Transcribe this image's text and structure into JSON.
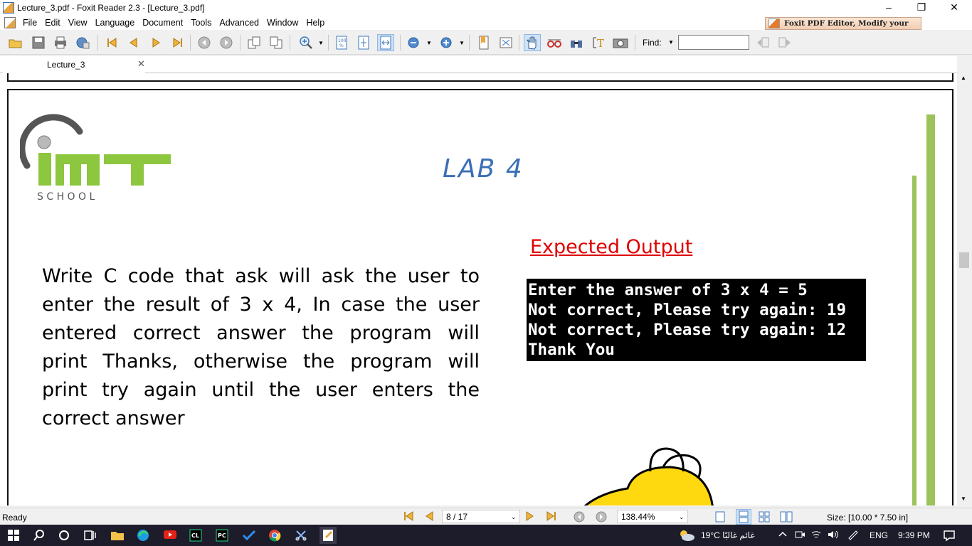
{
  "window": {
    "title": "Lecture_3.pdf - Foxit Reader 2.3 - [Lecture_3.pdf]"
  },
  "menu": [
    "File",
    "Edit",
    "View",
    "Language",
    "Document",
    "Tools",
    "Advanced",
    "Window",
    "Help"
  ],
  "promo": "Foxit PDF Editor, Modify your PDFs",
  "toolbar": {
    "find_label": "Find:"
  },
  "tabs": [
    {
      "label": "Lecture_3"
    }
  ],
  "document": {
    "logo_text": "IMT",
    "logo_subtitle": "S C H O O L",
    "title": "LAB 4",
    "task": "Write C code that ask will ask  the user to enter the result of 3 x 4, In case the user entered correct answer the program will print Thanks, otherwise the program will print try again until the user enters the correct answer",
    "expected_heading": "Expected Output",
    "console_lines": [
      "Enter the answer of 3 x 4 = 5",
      "Not correct, Please try again: 19",
      "Not correct, Please try again: 12",
      "Thank You"
    ]
  },
  "status": {
    "ready": "Ready",
    "page": "8 / 17",
    "zoom": "138.44%",
    "size": "Size: [10.00 * 7.50 in]"
  },
  "taskbar": {
    "weather": "19°C  غائم غالبًا",
    "lang": "ENG",
    "time": "9:39 PM"
  },
  "colors": {
    "lab_title": "#3a6fb6",
    "expected_heading": "#e00000",
    "logo_green": "#8dc63f"
  }
}
